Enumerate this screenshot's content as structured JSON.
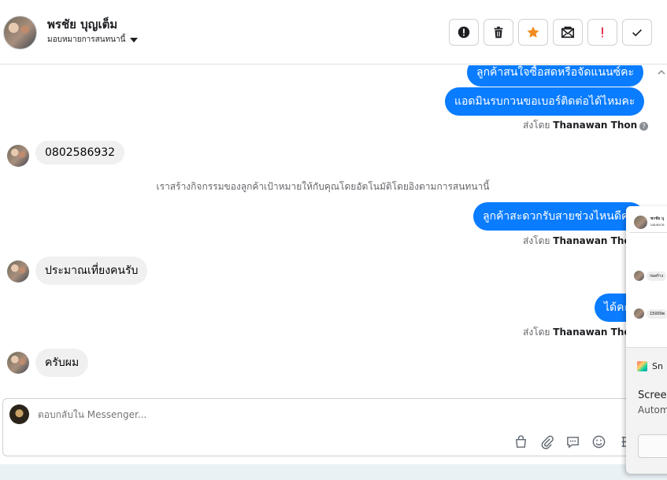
{
  "header": {
    "contact_name": "พรชัย บุญเต็ม",
    "assign_label": "มอบหมายการสนทนานี้",
    "actions": [
      {
        "icon": "alert-circle-icon",
        "color": "#1c1e21"
      },
      {
        "icon": "trash-icon",
        "color": "#1c1e21"
      },
      {
        "icon": "star-icon",
        "color": "#f28b1e"
      },
      {
        "icon": "mark-unread-icon",
        "color": "#1c1e21"
      },
      {
        "icon": "exclamation-icon",
        "color": "#e41e3f"
      },
      {
        "icon": "check-icon",
        "color": "#1c1e21"
      }
    ]
  },
  "messages": {
    "out_1": "ลูกค้าสนใจซื้อสดหรือจัดแนนซ์คะ",
    "out_2": "แอดมินรบกวนขอเบอร์ติดต่อได้ไหมคะ",
    "sent_by_prefix": "ส่งโดย",
    "sender": "Thanawan Thon",
    "in_1": "0802586932",
    "system_note": "เราสร้างกิจกรรมของลูกค้าเป้าหมายให้กับคุณโดยอัตโนมัติโดยอิงตามการสนทนานี้",
    "out_3": "ลูกค้าสะดวกรับสายช่วงไหนดีคะ",
    "in_2": "ประมาณเที่ยงคนรับ",
    "out_4": "ได้คะ",
    "in_3": "ครับผม"
  },
  "composer": {
    "placeholder": "ตอบกลับใน Messenger..."
  },
  "overlay": {
    "thumb_name": "พรชัย บุ",
    "thumb_sub": "มอบหมาย",
    "thumb_msg_1": "ก่อสร้าง",
    "thumb_msg_2": "15000ต",
    "app_name": "Sn",
    "title": "Screen",
    "subtitle": "Autom"
  },
  "colors": {
    "accent": "#0a7cff",
    "incoming_bubble": "#f0f0f0",
    "border": "#ced0d4"
  }
}
